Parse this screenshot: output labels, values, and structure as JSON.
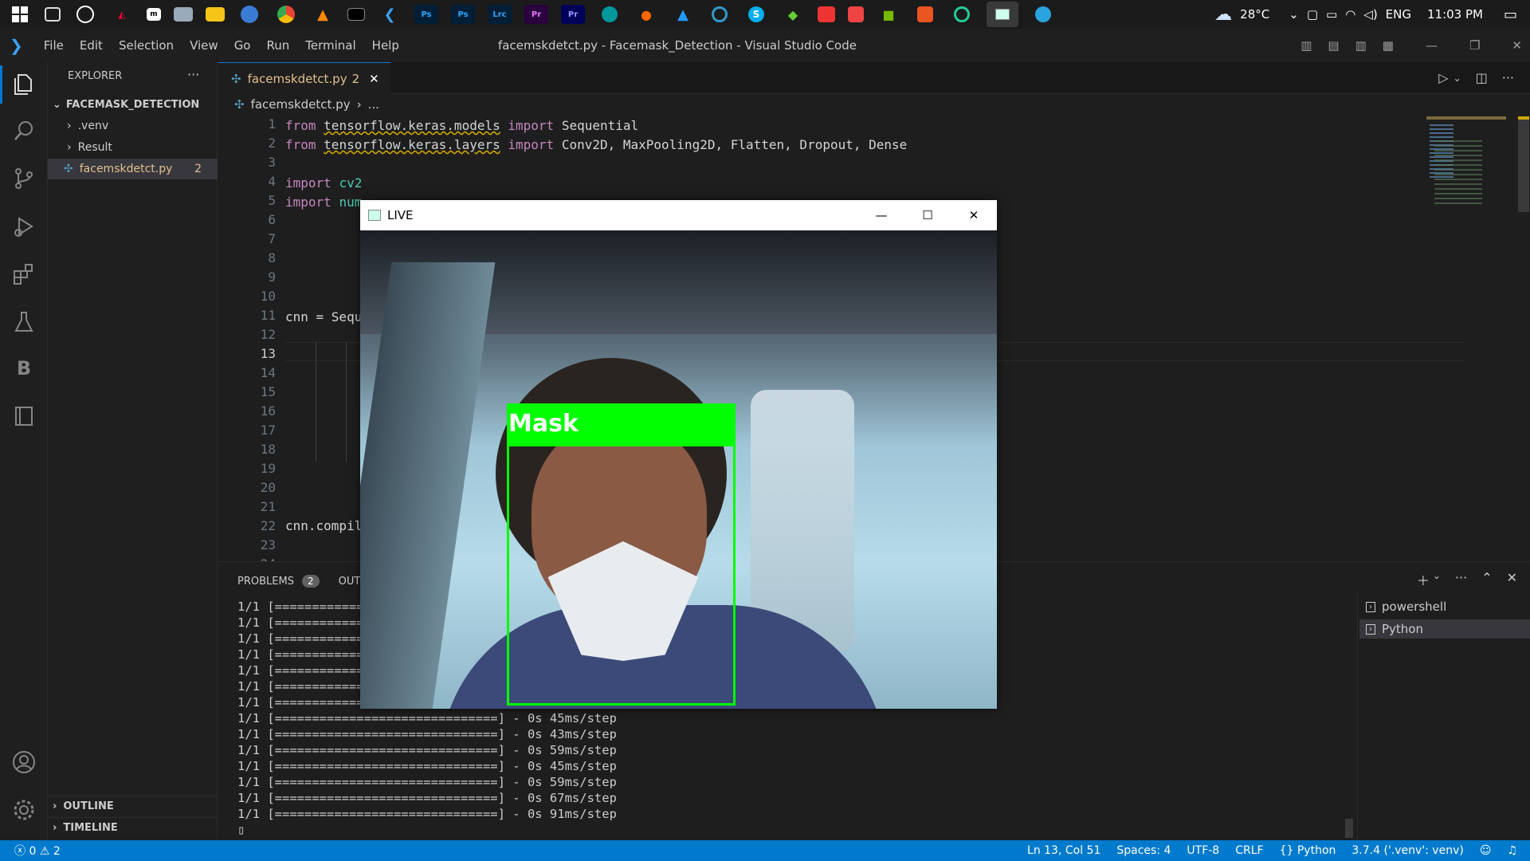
{
  "taskbar": {
    "weather": "28°C",
    "language": "ENG",
    "time": "11:03 PM"
  },
  "menubar": {
    "items": [
      "File",
      "Edit",
      "Selection",
      "View",
      "Go",
      "Run",
      "Terminal",
      "Help"
    ],
    "window_title": "facemskdetct.py - Facemask_Detection - Visual Studio Code"
  },
  "explorer": {
    "header": "EXPLORER",
    "more": "···",
    "folder": "FACEMASK_DETECTION",
    "items": [
      ".venv",
      "Result",
      "facemskdetct.py"
    ],
    "file_problem_count": "2",
    "outline": "OUTLINE",
    "timeline": "TIMELINE"
  },
  "editor": {
    "tab_label": "facemskdetct.py",
    "tab_badge": "2",
    "breadcrumb_file": "facemskdetct.py",
    "breadcrumb_more": "...",
    "line_numbers": [
      "1",
      "2",
      "3",
      "4",
      "5",
      "6",
      "7",
      "8",
      "9",
      "10",
      "11",
      "12",
      "13",
      "14",
      "15",
      "16",
      "17",
      "18",
      "19",
      "20",
      "21",
      "22",
      "23",
      "24"
    ],
    "lines": {
      "l1_kw1": "from",
      "l1_mod": "tensorflow.keras.models",
      "l1_kw2": "import",
      "l1_rest": "Sequential",
      "l2_kw1": "from",
      "l2_mod": "tensorflow.keras.layers",
      "l2_kw2": "import",
      "l2_rest": "Conv2D, MaxPooling2D, Flatten, Dropout, Dense",
      "l4_kw": "import",
      "l4_rest": "cv2",
      "l5_kw": "import",
      "l5_rest": "num",
      "l11": "cnn = Sequ",
      "l22": "cnn.compil"
    }
  },
  "panel": {
    "tab_problems": "PROBLEMS",
    "problems_count": "2",
    "tab_output": "OUT",
    "terminals": [
      "powershell",
      "Python"
    ],
    "term_lines_partial": [
      "1/1 [============",
      "1/1 [============",
      "1/1 [============",
      "1/1 [============",
      "1/1 [============",
      "1/1 [============",
      "1/1 [============"
    ],
    "term_lines_full": [
      "1/1 [==============================] - 0s 45ms/step",
      "1/1 [==============================] - 0s 43ms/step",
      "1/1 [==============================] - 0s 59ms/step",
      "1/1 [==============================] - 0s 45ms/step",
      "1/1 [==============================] - 0s 59ms/step",
      "1/1 [==============================] - 0s 67ms/step",
      "1/1 [==============================] - 0s 91ms/step"
    ],
    "cursor_line": "▯"
  },
  "live_window": {
    "title": "LIVE",
    "detection_label": "Mask",
    "label_color": "#00ff00"
  },
  "statusbar": {
    "errors": "0",
    "warnings": "2",
    "position": "Ln 13, Col 51",
    "spaces": "Spaces: 4",
    "encoding": "UTF-8",
    "eol": "CRLF",
    "language": "Python",
    "interpreter": "3.7.4 ('.venv': venv)"
  },
  "colors": {
    "accent": "#007acc",
    "tab_modified": "#e2c08d"
  }
}
